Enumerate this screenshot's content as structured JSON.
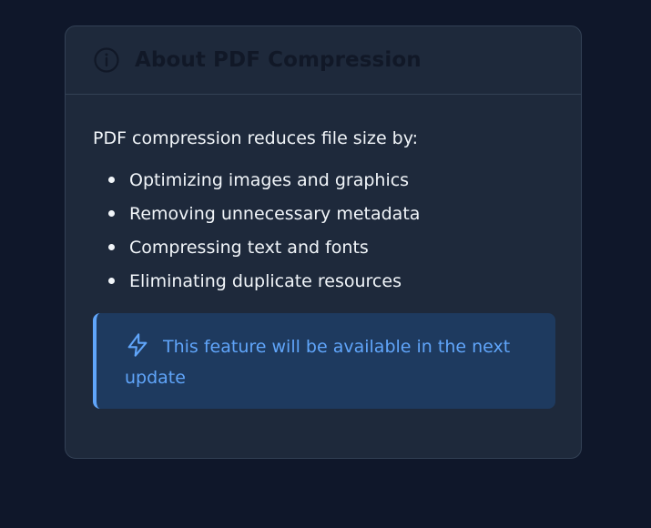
{
  "card": {
    "title": "About PDF Compression",
    "title_icon": "info-icon",
    "intro": "PDF compression reduces file size by:",
    "features": [
      "Optimizing images and graphics",
      "Removing unnecessary metadata",
      "Compressing text and fonts",
      "Eliminating duplicate resources"
    ],
    "notice": {
      "icon": "lightning-icon",
      "text": "This feature will be available in the next update"
    }
  },
  "colors": {
    "page_background": "#0f172a",
    "card_background": "#1e293b",
    "accent": "#60a5fa",
    "notice_background": "#1e3a5f"
  }
}
